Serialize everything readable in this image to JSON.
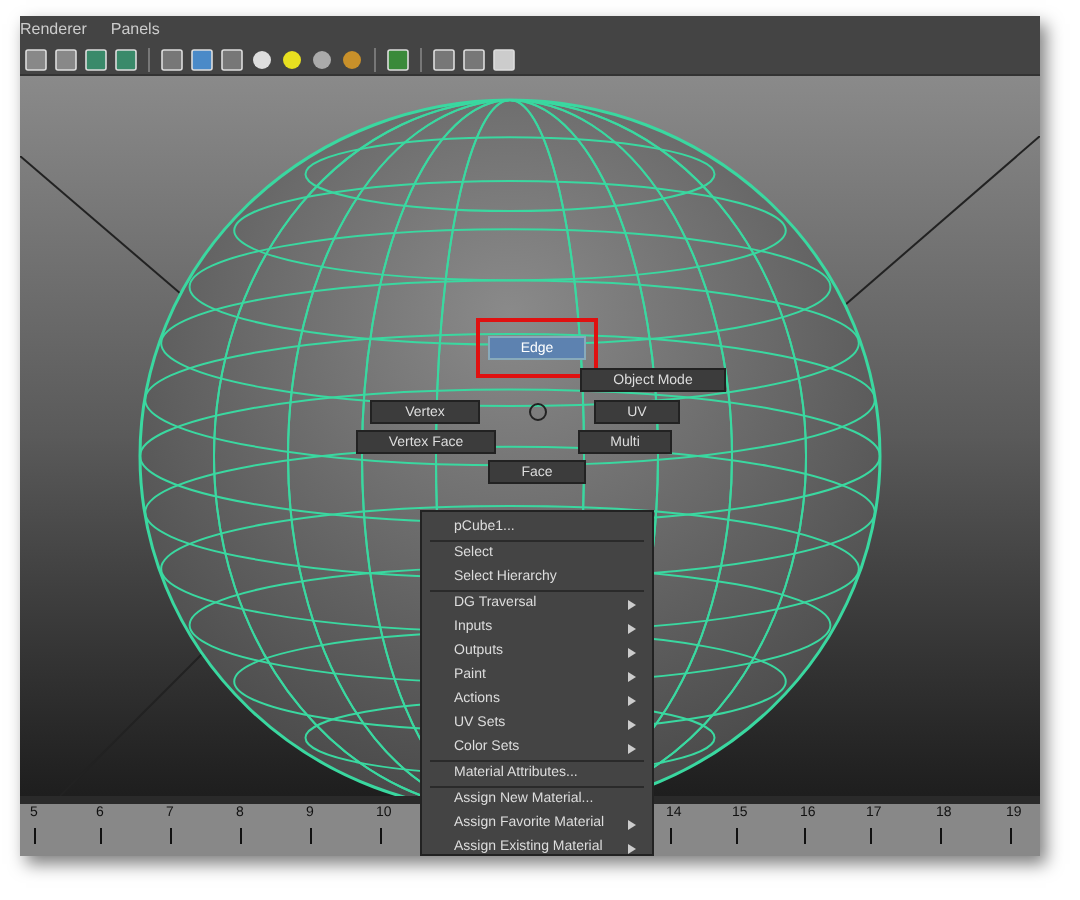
{
  "menu_bar": [
    "Renderer",
    "Panels"
  ],
  "marking_menu": [
    {
      "label": "Edge",
      "selected": true
    },
    {
      "label": "Object Mode",
      "selected": false
    },
    {
      "label": "Vertex",
      "selected": false
    },
    {
      "label": "UV",
      "selected": false
    },
    {
      "label": "Vertex Face",
      "selected": false
    },
    {
      "label": "Multi",
      "selected": false
    },
    {
      "label": "Face",
      "selected": false
    }
  ],
  "context_menu": {
    "sections": [
      [
        {
          "label": "pCube1...",
          "submenu": false
        }
      ],
      [
        {
          "label": "Select",
          "submenu": false
        },
        {
          "label": "Select Hierarchy",
          "submenu": false
        }
      ],
      [
        {
          "label": "DG Traversal",
          "submenu": true
        },
        {
          "label": "Inputs",
          "submenu": true
        },
        {
          "label": "Outputs",
          "submenu": true
        },
        {
          "label": "Paint",
          "submenu": true
        },
        {
          "label": "Actions",
          "submenu": true
        },
        {
          "label": "UV Sets",
          "submenu": true
        },
        {
          "label": "Color Sets",
          "submenu": true
        }
      ],
      [
        {
          "label": "Material Attributes...",
          "submenu": false
        }
      ],
      [
        {
          "label": "Assign New Material...",
          "submenu": false
        },
        {
          "label": "Assign Favorite Material",
          "submenu": true
        },
        {
          "label": "Assign Existing Material",
          "submenu": true
        }
      ]
    ]
  },
  "timeline": {
    "ticks": [
      "5",
      "6",
      "7",
      "8",
      "9",
      "10",
      "14",
      "15",
      "16",
      "17",
      "18",
      "19"
    ]
  }
}
